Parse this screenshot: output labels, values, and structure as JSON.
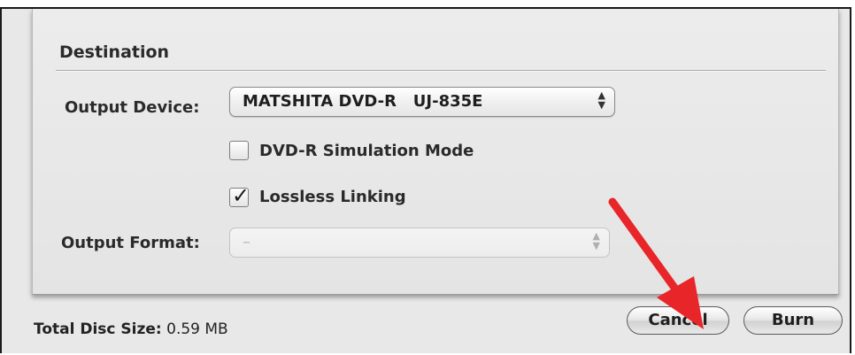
{
  "top_remnant": "g p",
  "destination": {
    "title": "Destination",
    "output_device_label": "Output Device:",
    "output_device_value": "MATSHITA DVD-R   UJ-835E",
    "dvd_r_simulation_label": "DVD-R Simulation Mode",
    "dvd_r_simulation_checked": false,
    "lossless_linking_label": "Lossless Linking",
    "lossless_linking_checked": true,
    "output_format_label": "Output Format:",
    "output_format_value": "–"
  },
  "footer": {
    "total_disc_size_label": "Total Disc Size:",
    "total_disc_size_value": "0.59 MB",
    "cancel_label": "Cancel",
    "burn_label": "Burn"
  },
  "icons": {
    "popup_arrows": "up-down-arrows-icon",
    "checkmark": "checkmark-icon",
    "annotation_arrow": "red-arrow-icon"
  },
  "colors": {
    "annotation_arrow": "#e8262a",
    "panel_background": "#e8e8e8"
  }
}
